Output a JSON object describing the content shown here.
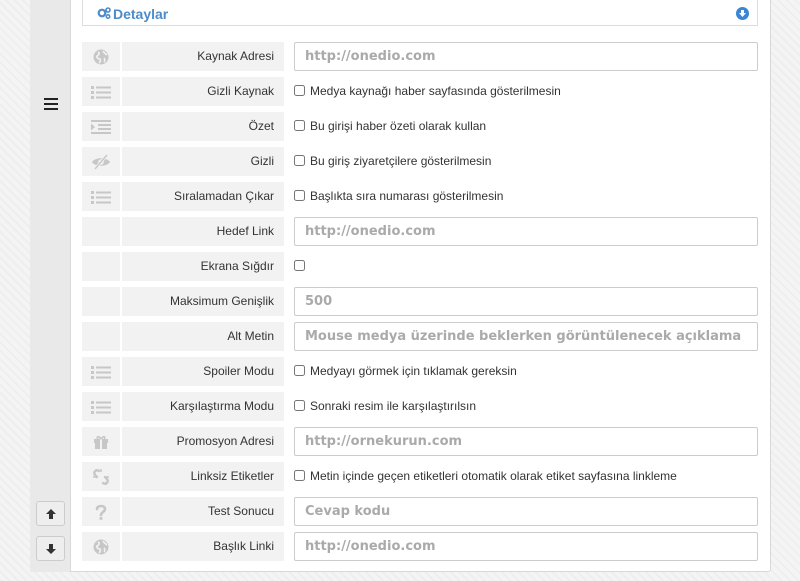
{
  "panel": {
    "title": "Detaylar"
  },
  "rows": [
    {
      "kind": "input",
      "icon": "globe-icon",
      "label": "Kaynak Adresi",
      "placeholder": "http://onedio.com"
    },
    {
      "kind": "check",
      "icon": "list-icon",
      "label": "Gizli Kaynak",
      "check_label": "Medya kaynağı haber sayfasında gösterilmesin"
    },
    {
      "kind": "check",
      "icon": "indent-icon",
      "label": "Özet",
      "check_label": "Bu girişi haber özeti olarak kullan"
    },
    {
      "kind": "check",
      "icon": "eye-slash-icon",
      "label": "Gizli",
      "check_label": "Bu giriş ziyaretçilere gösterilmesin"
    },
    {
      "kind": "check",
      "icon": "list-icon",
      "label": "Sıralamadan Çıkar",
      "check_label": "Başlıkta sıra numarası gösterilmesin"
    },
    {
      "kind": "input",
      "icon": "",
      "label": "Hedef Link",
      "placeholder": "http://onedio.com"
    },
    {
      "kind": "check",
      "icon": "",
      "label": "Ekrana Sığdır",
      "check_label": ""
    },
    {
      "kind": "input",
      "icon": "",
      "label": "Maksimum Genişlik",
      "placeholder": "500"
    },
    {
      "kind": "input",
      "icon": "",
      "label": "Alt Metin",
      "placeholder": "Mouse medya üzerinde beklerken görüntülenecek açıklama"
    },
    {
      "kind": "check",
      "icon": "list-icon",
      "label": "Spoiler Modu",
      "check_label": "Medyayı görmek için tıklamak gereksin"
    },
    {
      "kind": "check",
      "icon": "list-icon",
      "label": "Karşılaştırma Modu",
      "check_label": "Sonraki resim ile karşılaştırılsın"
    },
    {
      "kind": "input",
      "icon": "gift-icon",
      "label": "Promosyon Adresi",
      "placeholder": "http://ornekurun.com"
    },
    {
      "kind": "check",
      "icon": "unlink-icon",
      "label": "Linksiz Etiketler",
      "check_label": "Metin içinde geçen etiketleri otomatik olarak etiket sayfasına linkleme"
    },
    {
      "kind": "input",
      "icon": "question-icon",
      "label": "Test Sonucu",
      "placeholder": "Cevap kodu"
    },
    {
      "kind": "input",
      "icon": "globe-icon",
      "label": "Başlık Linki",
      "placeholder": "http://onedio.com"
    }
  ]
}
